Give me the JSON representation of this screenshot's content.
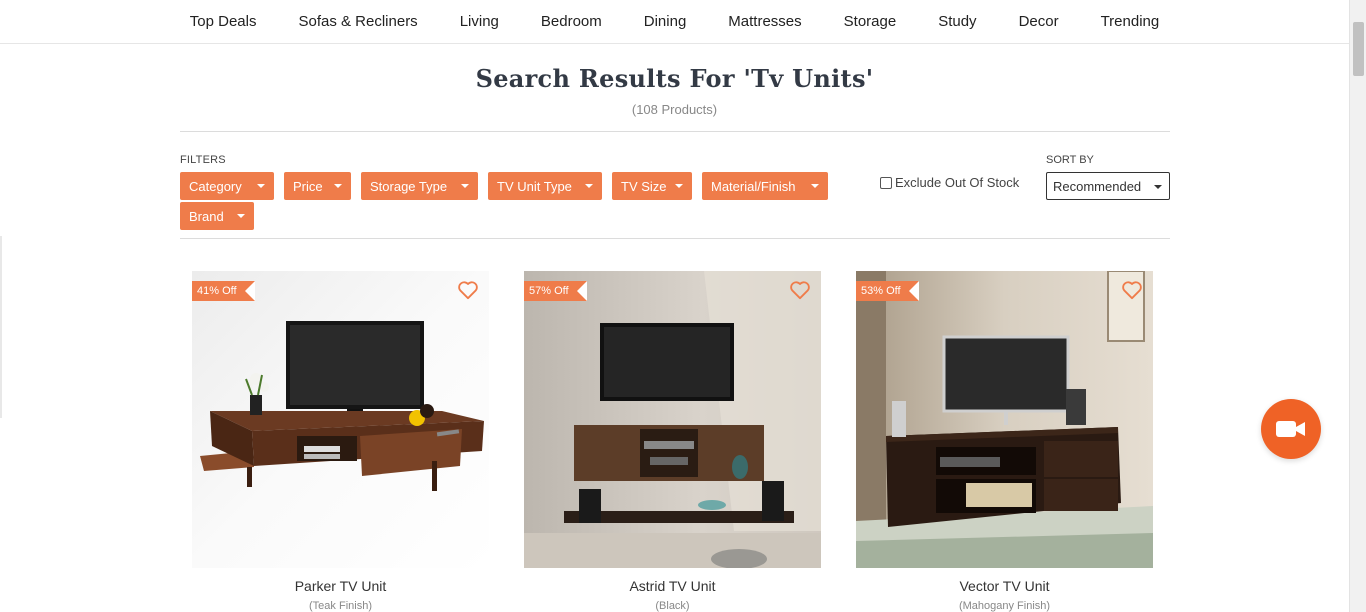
{
  "nav": {
    "items": [
      "Top Deals",
      "Sofas & Recliners",
      "Living",
      "Bedroom",
      "Dining",
      "Mattresses",
      "Storage",
      "Study",
      "Decor",
      "Trending"
    ]
  },
  "search": {
    "title": "Search Results For 'Tv Units'",
    "count": "(108 Products)"
  },
  "filters": {
    "label": "FILTERS",
    "buttons": [
      "Category",
      "Price",
      "Storage Type",
      "TV Unit Type",
      "TV Size",
      "Material/Finish",
      "Brand"
    ],
    "exclude_label": "Exclude Out Of Stock",
    "exclude_checked": false
  },
  "sort": {
    "label": "SORT BY",
    "selected": "Recommended"
  },
  "products": [
    {
      "name": "Parker TV Unit",
      "finish": "(Teak Finish)",
      "discount": "41% Off"
    },
    {
      "name": "Astrid TV Unit",
      "finish": "(Black)",
      "discount": "57% Off"
    },
    {
      "name": "Vector TV Unit",
      "finish": "(Mahogany Finish)",
      "discount": "53% Off"
    }
  ],
  "colors": {
    "accent": "#ef7c4a",
    "video_button": "#ef6226"
  },
  "icons": {
    "wishlist": "heart-outline-icon",
    "video": "video-camera-icon",
    "dropdown": "caret-down-icon"
  }
}
